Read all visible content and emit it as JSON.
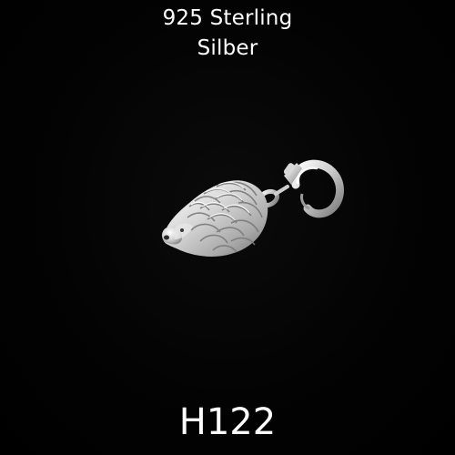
{
  "header": {
    "line1": "925 Sterling",
    "line2": "Silber"
  },
  "product": {
    "code": "H122",
    "image_subject": "silver-hedgehog-charm-with-lobster-clasp"
  },
  "colors": {
    "background": "#000000",
    "text": "#ffffff",
    "silver_light": "#f2f2f2",
    "silver_mid": "#bdbdbd",
    "silver_dark": "#6e6e6e"
  }
}
